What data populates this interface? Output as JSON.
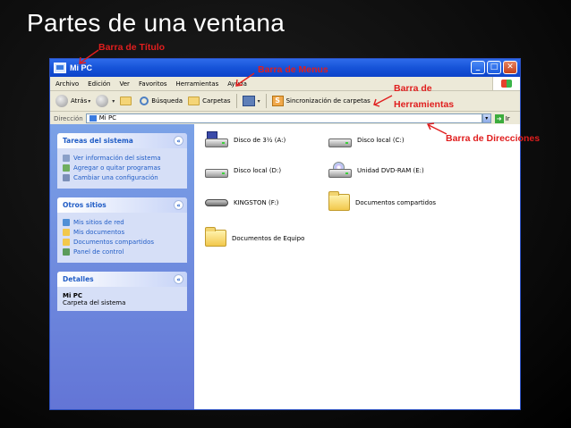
{
  "slide": {
    "title": "Partes de una ventana"
  },
  "annotations": {
    "title_bar": "Barra de Título",
    "menu_bar": "Barra de Menus",
    "toolbar_line1": "Barra de",
    "toolbar_line2": "Herramientas",
    "address_bar": "Barra de Direcciones"
  },
  "window": {
    "title": "Mi PC",
    "controls": {
      "minimize": "_",
      "maximize": "□",
      "close": "✕"
    },
    "menu": [
      "Archivo",
      "Edición",
      "Ver",
      "Favoritos",
      "Herramientas",
      "Ayuda"
    ],
    "toolbar": {
      "back": "Atrás",
      "search": "Búsqueda",
      "folders": "Carpetas",
      "sync": "Sincronización de carpetas"
    },
    "address": {
      "label": "Dirección",
      "value": "Mi PC",
      "go": "Ir"
    },
    "left_panels": [
      {
        "title": "Tareas del sistema",
        "items": [
          "Ver información del sistema",
          "Agregar o quitar programas",
          "Cambiar una configuración"
        ]
      },
      {
        "title": "Otros sitios",
        "items": [
          "Mis sitios de red",
          "Mis documentos",
          "Documentos compartidos",
          "Panel de control"
        ]
      }
    ],
    "details": {
      "title": "Detalles",
      "name": "Mi PC",
      "description": "Carpeta del sistema"
    },
    "items": [
      {
        "label": "Disco de 3½ (A:)",
        "icon": "floppy-icon"
      },
      {
        "label": "Disco local (C:)",
        "icon": "hard-drive-icon"
      },
      {
        "label": "Disco local (D:)",
        "icon": "hard-drive-icon"
      },
      {
        "label": "Unidad DVD-RAM (E:)",
        "icon": "dvd-drive-icon"
      },
      {
        "label": "KINGSTON (F:)",
        "icon": "usb-drive-icon"
      },
      {
        "label": "Documentos compartidos",
        "icon": "folder-icon"
      },
      {
        "label": "Documentos de Equipo",
        "icon": "folder-icon"
      }
    ]
  }
}
